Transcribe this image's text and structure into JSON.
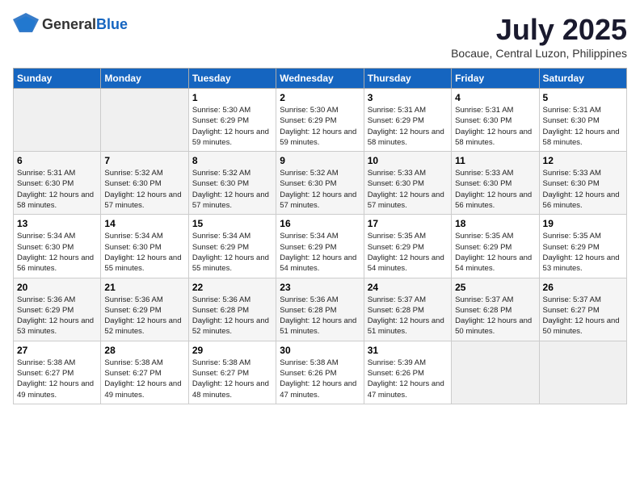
{
  "header": {
    "logo_general": "General",
    "logo_blue": "Blue",
    "month": "July 2025",
    "location": "Bocaue, Central Luzon, Philippines"
  },
  "weekdays": [
    "Sunday",
    "Monday",
    "Tuesday",
    "Wednesday",
    "Thursday",
    "Friday",
    "Saturday"
  ],
  "weeks": [
    [
      {
        "day": "",
        "info": ""
      },
      {
        "day": "",
        "info": ""
      },
      {
        "day": "1",
        "info": "Sunrise: 5:30 AM\nSunset: 6:29 PM\nDaylight: 12 hours and 59 minutes."
      },
      {
        "day": "2",
        "info": "Sunrise: 5:30 AM\nSunset: 6:29 PM\nDaylight: 12 hours and 59 minutes."
      },
      {
        "day": "3",
        "info": "Sunrise: 5:31 AM\nSunset: 6:29 PM\nDaylight: 12 hours and 58 minutes."
      },
      {
        "day": "4",
        "info": "Sunrise: 5:31 AM\nSunset: 6:30 PM\nDaylight: 12 hours and 58 minutes."
      },
      {
        "day": "5",
        "info": "Sunrise: 5:31 AM\nSunset: 6:30 PM\nDaylight: 12 hours and 58 minutes."
      }
    ],
    [
      {
        "day": "6",
        "info": "Sunrise: 5:31 AM\nSunset: 6:30 PM\nDaylight: 12 hours and 58 minutes."
      },
      {
        "day": "7",
        "info": "Sunrise: 5:32 AM\nSunset: 6:30 PM\nDaylight: 12 hours and 57 minutes."
      },
      {
        "day": "8",
        "info": "Sunrise: 5:32 AM\nSunset: 6:30 PM\nDaylight: 12 hours and 57 minutes."
      },
      {
        "day": "9",
        "info": "Sunrise: 5:32 AM\nSunset: 6:30 PM\nDaylight: 12 hours and 57 minutes."
      },
      {
        "day": "10",
        "info": "Sunrise: 5:33 AM\nSunset: 6:30 PM\nDaylight: 12 hours and 57 minutes."
      },
      {
        "day": "11",
        "info": "Sunrise: 5:33 AM\nSunset: 6:30 PM\nDaylight: 12 hours and 56 minutes."
      },
      {
        "day": "12",
        "info": "Sunrise: 5:33 AM\nSunset: 6:30 PM\nDaylight: 12 hours and 56 minutes."
      }
    ],
    [
      {
        "day": "13",
        "info": "Sunrise: 5:34 AM\nSunset: 6:30 PM\nDaylight: 12 hours and 56 minutes."
      },
      {
        "day": "14",
        "info": "Sunrise: 5:34 AM\nSunset: 6:30 PM\nDaylight: 12 hours and 55 minutes."
      },
      {
        "day": "15",
        "info": "Sunrise: 5:34 AM\nSunset: 6:29 PM\nDaylight: 12 hours and 55 minutes."
      },
      {
        "day": "16",
        "info": "Sunrise: 5:34 AM\nSunset: 6:29 PM\nDaylight: 12 hours and 54 minutes."
      },
      {
        "day": "17",
        "info": "Sunrise: 5:35 AM\nSunset: 6:29 PM\nDaylight: 12 hours and 54 minutes."
      },
      {
        "day": "18",
        "info": "Sunrise: 5:35 AM\nSunset: 6:29 PM\nDaylight: 12 hours and 54 minutes."
      },
      {
        "day": "19",
        "info": "Sunrise: 5:35 AM\nSunset: 6:29 PM\nDaylight: 12 hours and 53 minutes."
      }
    ],
    [
      {
        "day": "20",
        "info": "Sunrise: 5:36 AM\nSunset: 6:29 PM\nDaylight: 12 hours and 53 minutes."
      },
      {
        "day": "21",
        "info": "Sunrise: 5:36 AM\nSunset: 6:29 PM\nDaylight: 12 hours and 52 minutes."
      },
      {
        "day": "22",
        "info": "Sunrise: 5:36 AM\nSunset: 6:28 PM\nDaylight: 12 hours and 52 minutes."
      },
      {
        "day": "23",
        "info": "Sunrise: 5:36 AM\nSunset: 6:28 PM\nDaylight: 12 hours and 51 minutes."
      },
      {
        "day": "24",
        "info": "Sunrise: 5:37 AM\nSunset: 6:28 PM\nDaylight: 12 hours and 51 minutes."
      },
      {
        "day": "25",
        "info": "Sunrise: 5:37 AM\nSunset: 6:28 PM\nDaylight: 12 hours and 50 minutes."
      },
      {
        "day": "26",
        "info": "Sunrise: 5:37 AM\nSunset: 6:27 PM\nDaylight: 12 hours and 50 minutes."
      }
    ],
    [
      {
        "day": "27",
        "info": "Sunrise: 5:38 AM\nSunset: 6:27 PM\nDaylight: 12 hours and 49 minutes."
      },
      {
        "day": "28",
        "info": "Sunrise: 5:38 AM\nSunset: 6:27 PM\nDaylight: 12 hours and 49 minutes."
      },
      {
        "day": "29",
        "info": "Sunrise: 5:38 AM\nSunset: 6:27 PM\nDaylight: 12 hours and 48 minutes."
      },
      {
        "day": "30",
        "info": "Sunrise: 5:38 AM\nSunset: 6:26 PM\nDaylight: 12 hours and 47 minutes."
      },
      {
        "day": "31",
        "info": "Sunrise: 5:39 AM\nSunset: 6:26 PM\nDaylight: 12 hours and 47 minutes."
      },
      {
        "day": "",
        "info": ""
      },
      {
        "day": "",
        "info": ""
      }
    ]
  ]
}
